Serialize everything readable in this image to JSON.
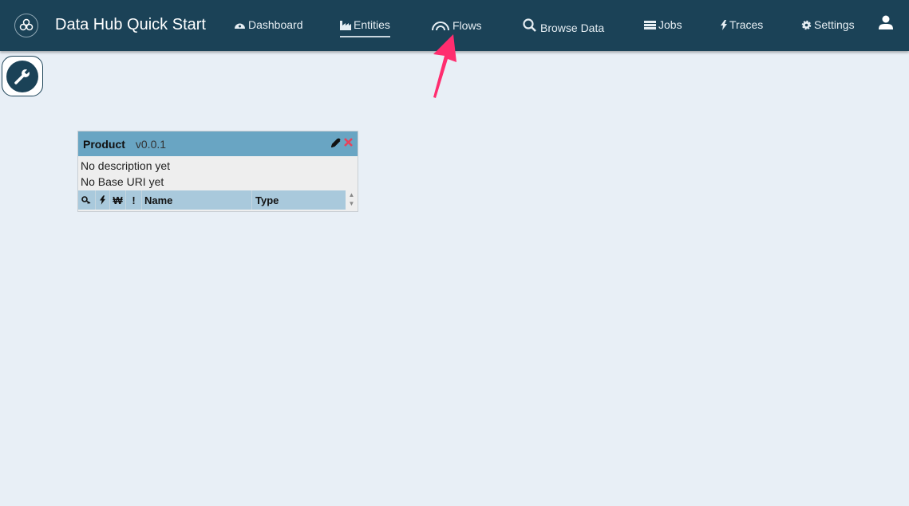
{
  "header": {
    "title": "Data Hub Quick Start",
    "nav": [
      {
        "label": "Dashboard",
        "icon": "dashboard-icon"
      },
      {
        "label": "Entities",
        "icon": "factory-icon",
        "active": true
      },
      {
        "label": "Flows",
        "icon": "flows-icon"
      },
      {
        "label": "Browse Data",
        "icon": "search-icon"
      },
      {
        "label": "Jobs",
        "icon": "jobs-icon"
      },
      {
        "label": "Traces",
        "icon": "bolt-icon"
      },
      {
        "label": "Settings",
        "icon": "gear-icon"
      }
    ],
    "user_icon": "user-icon"
  },
  "toolbar": {
    "tools_icon": "wrench-icon"
  },
  "entity": {
    "name": "Product",
    "version": "v0.0.1",
    "description": "No description yet",
    "base_uri": "No Base URI yet",
    "columns": {
      "key": "key-icon",
      "elastic": "bolt-icon",
      "range": "won-icon",
      "required": "!",
      "name": "Name",
      "type": "Type"
    }
  },
  "colors": {
    "topbar": "#1b4257",
    "card_header": "#69a5c3",
    "table_header": "#a9c9dc",
    "delete": "#e8425a",
    "annotation_arrow": "#ff2d6f"
  }
}
